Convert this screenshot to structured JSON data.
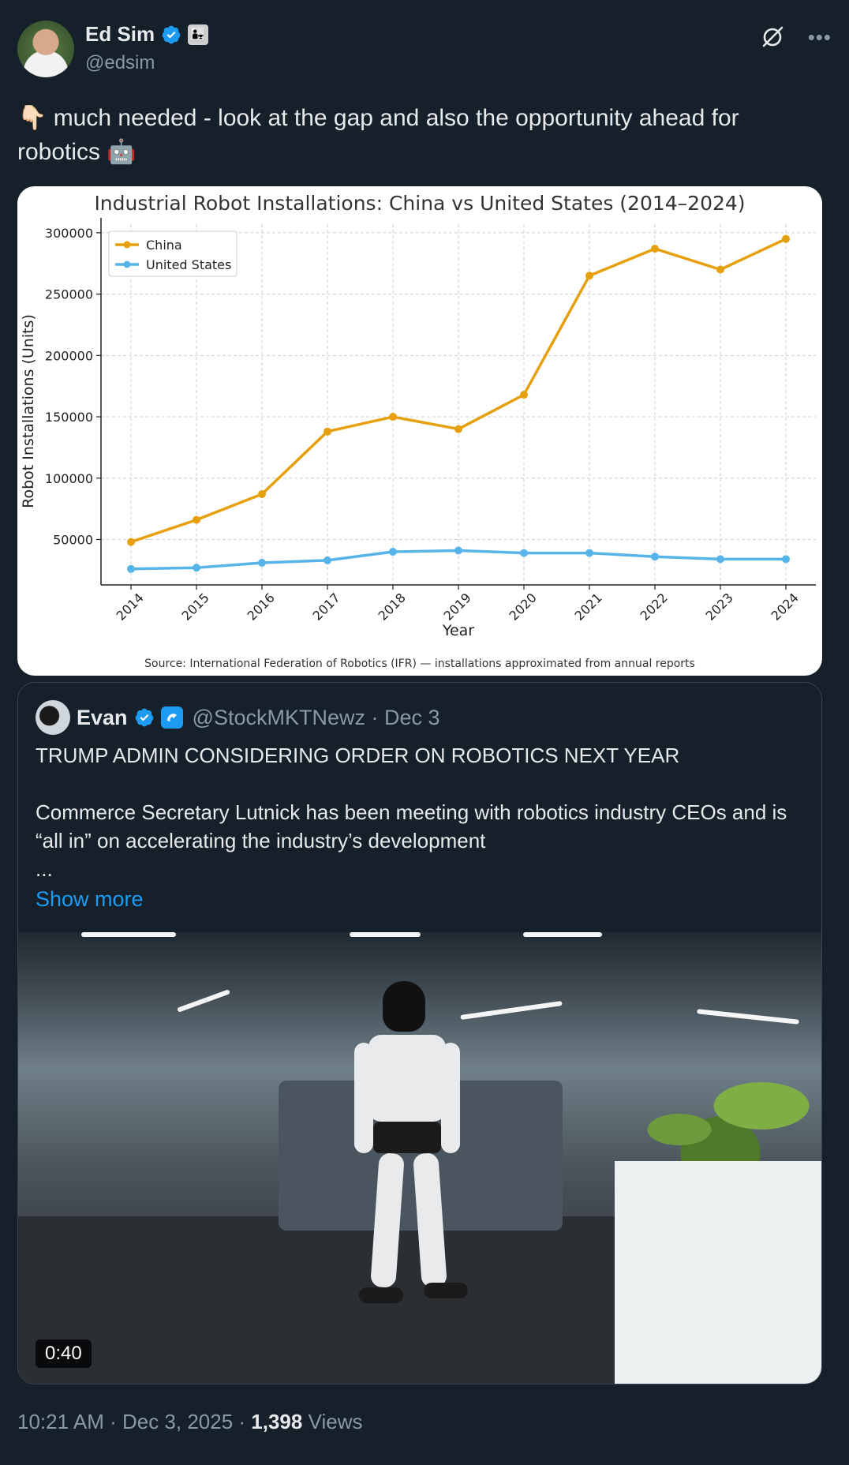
{
  "author": {
    "display_name": "Ed Sim",
    "handle": "@edsim",
    "badge_emoji": "👨‍👧"
  },
  "tweet": {
    "text_line1": "👇🏻 much needed - look at the gap and also the opportunity ahead for",
    "text_line2": "robotics 🤖"
  },
  "chart_data": {
    "type": "line",
    "title": "Industrial Robot Installations: China vs United States (2014–2024)",
    "xlabel": "Year",
    "ylabel": "Robot Installations (Units)",
    "x": [
      "2014",
      "2015",
      "2016",
      "2017",
      "2018",
      "2019",
      "2020",
      "2021",
      "2022",
      "2023",
      "2024"
    ],
    "series": [
      {
        "name": "China",
        "color": "#e6a00d",
        "values": [
          48000,
          66000,
          87000,
          138000,
          150000,
          140000,
          168000,
          265000,
          287000,
          270000,
          295000
        ]
      },
      {
        "name": "United States",
        "color": "#56b4e9",
        "values": [
          26000,
          27000,
          31000,
          33000,
          40000,
          41000,
          39000,
          39000,
          36000,
          34000,
          34000
        ]
      }
    ],
    "yticks": [
      "50000",
      "100000",
      "150000",
      "200000",
      "250000",
      "300000"
    ],
    "ylim": [
      13000,
      307000
    ],
    "grid": true,
    "legend": "top-left",
    "source": "Source: International Federation of Robotics (IFR) — installations approximated from annual reports"
  },
  "quote": {
    "name": "Evan",
    "handle_date": "@StockMKTNewz · Dec 3",
    "headline": "TRUMP ADMIN CONSIDERING ORDER ON ROBOTICS NEXT YEAR",
    "body": "Commerce Secretary Lutnick has been meeting with robotics industry CEOs and is “all in” on accelerating the industry’s development",
    "ellipsis": "...",
    "show_more": "Show more",
    "video_duration": "0:40"
  },
  "meta": {
    "time_date": "10:21 AM · Dec 3, 2025 · ",
    "views_count": "1,398",
    "views_label": " Views"
  }
}
